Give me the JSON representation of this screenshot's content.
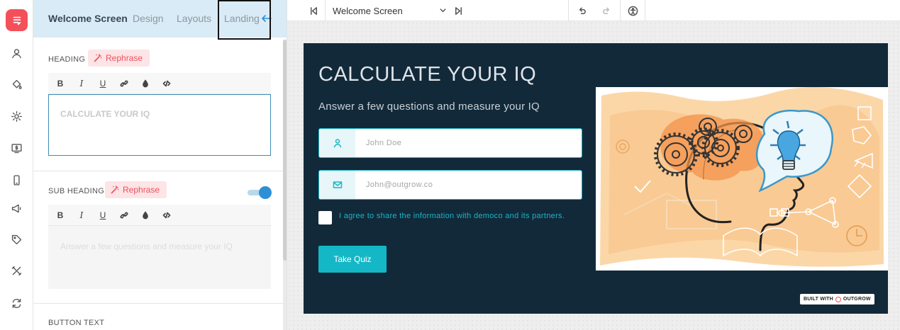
{
  "panel": {
    "tabs": [
      {
        "label": "Welcome Screen",
        "active": true
      },
      {
        "label": "Design"
      },
      {
        "label": "Layouts"
      },
      {
        "label": "Landing"
      }
    ],
    "heading_label": "HEADING",
    "rephrase_label": "Rephrase",
    "heading_value": "CALCULATE YOUR IQ",
    "subheading_label": "SUB HEADING",
    "subheading_value": "Answer a few questions and measure your IQ",
    "button_text_label": "BUTTON TEXT",
    "toolbar": [
      "B",
      "I",
      "U",
      "link-icon",
      "color-drop-icon",
      "code-icon"
    ]
  },
  "topbar": {
    "screen_select": "Welcome Screen"
  },
  "preview": {
    "title": "CALCULATE YOUR IQ",
    "subtitle": "Answer a few questions and measure your IQ",
    "name_placeholder": "John Doe",
    "email_placeholder": "John@outgrow.co",
    "consent": "I agree to share the information with democo and its partners.",
    "cta": "Take Quiz",
    "badge_prefix": "BUILT WITH",
    "badge_brand": "OUTGROW"
  },
  "colors": {
    "brand": "#f4505a",
    "card_bg": "#12293a",
    "accent": "#13b7c6",
    "tab_bar": "#d9ebf6"
  }
}
